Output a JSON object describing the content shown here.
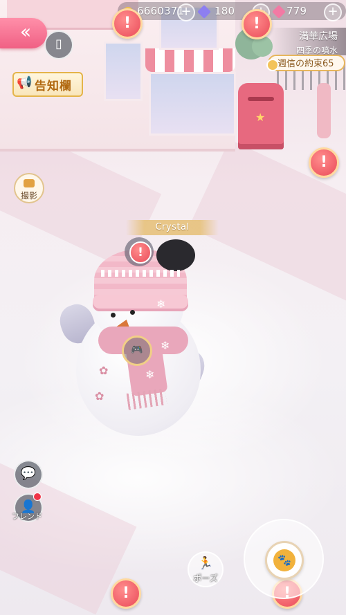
{
  "resources": {
    "gold": "6660371",
    "diamond": "180",
    "pink_gem": "779"
  },
  "hud": {
    "notice_board": "告知欄",
    "photo": "撮影",
    "friends": "フレンド",
    "pose": "ポーズ"
  },
  "location": {
    "area": "満華広場",
    "sub_area": "四季の噴水",
    "quest": "週信の約束65"
  },
  "player": {
    "name": "Crystal"
  },
  "colors": {
    "accent_pink": "#f06084",
    "alert_red": "#ea4b59",
    "gold": "#e7b65c"
  }
}
